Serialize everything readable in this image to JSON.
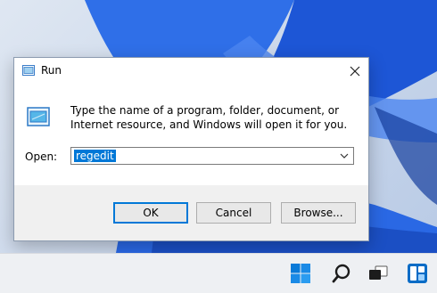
{
  "dialog": {
    "title": "Run",
    "description": "Type the name of a program, folder, document, or Internet resource, and Windows will open it for you.",
    "open_label": "Open:",
    "open_value": "regedit",
    "buttons": {
      "ok": "OK",
      "cancel": "Cancel",
      "browse": "Browse..."
    }
  },
  "icons": {
    "title": "run-icon",
    "body": "run-icon",
    "close": "close-icon",
    "combo": "chevron-down-icon",
    "taskbar": [
      "start-icon",
      "search-icon",
      "task-view-icon",
      "widgets-icon"
    ]
  },
  "colors": {
    "accent": "#0078d7",
    "wallpaper_blue": "#1f5fe0"
  }
}
